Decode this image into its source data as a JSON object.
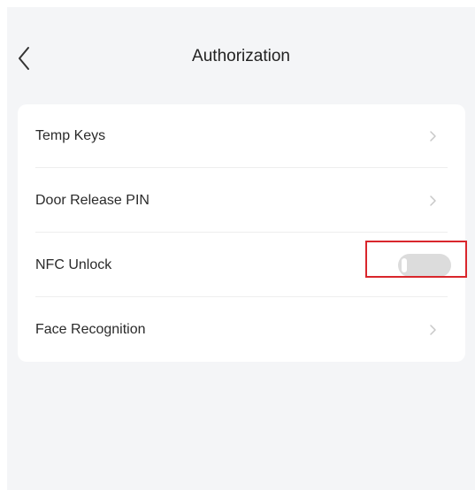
{
  "header": {
    "title": "Authorization"
  },
  "menu": {
    "items": [
      {
        "label": "Temp Keys",
        "type": "link"
      },
      {
        "label": "Door Release PIN",
        "type": "link"
      },
      {
        "label": "NFC Unlock",
        "type": "toggle",
        "enabled": false
      },
      {
        "label": "Face Recognition",
        "type": "link"
      }
    ]
  },
  "icons": {
    "back": "chevron-left-icon",
    "row": "chevron-right-icon"
  },
  "colors": {
    "background": "#f4f5f7",
    "card": "#ffffff",
    "toggle_off": "#dcdcdc",
    "highlight": "#d9262c",
    "chevron": "#c8c8c8"
  }
}
